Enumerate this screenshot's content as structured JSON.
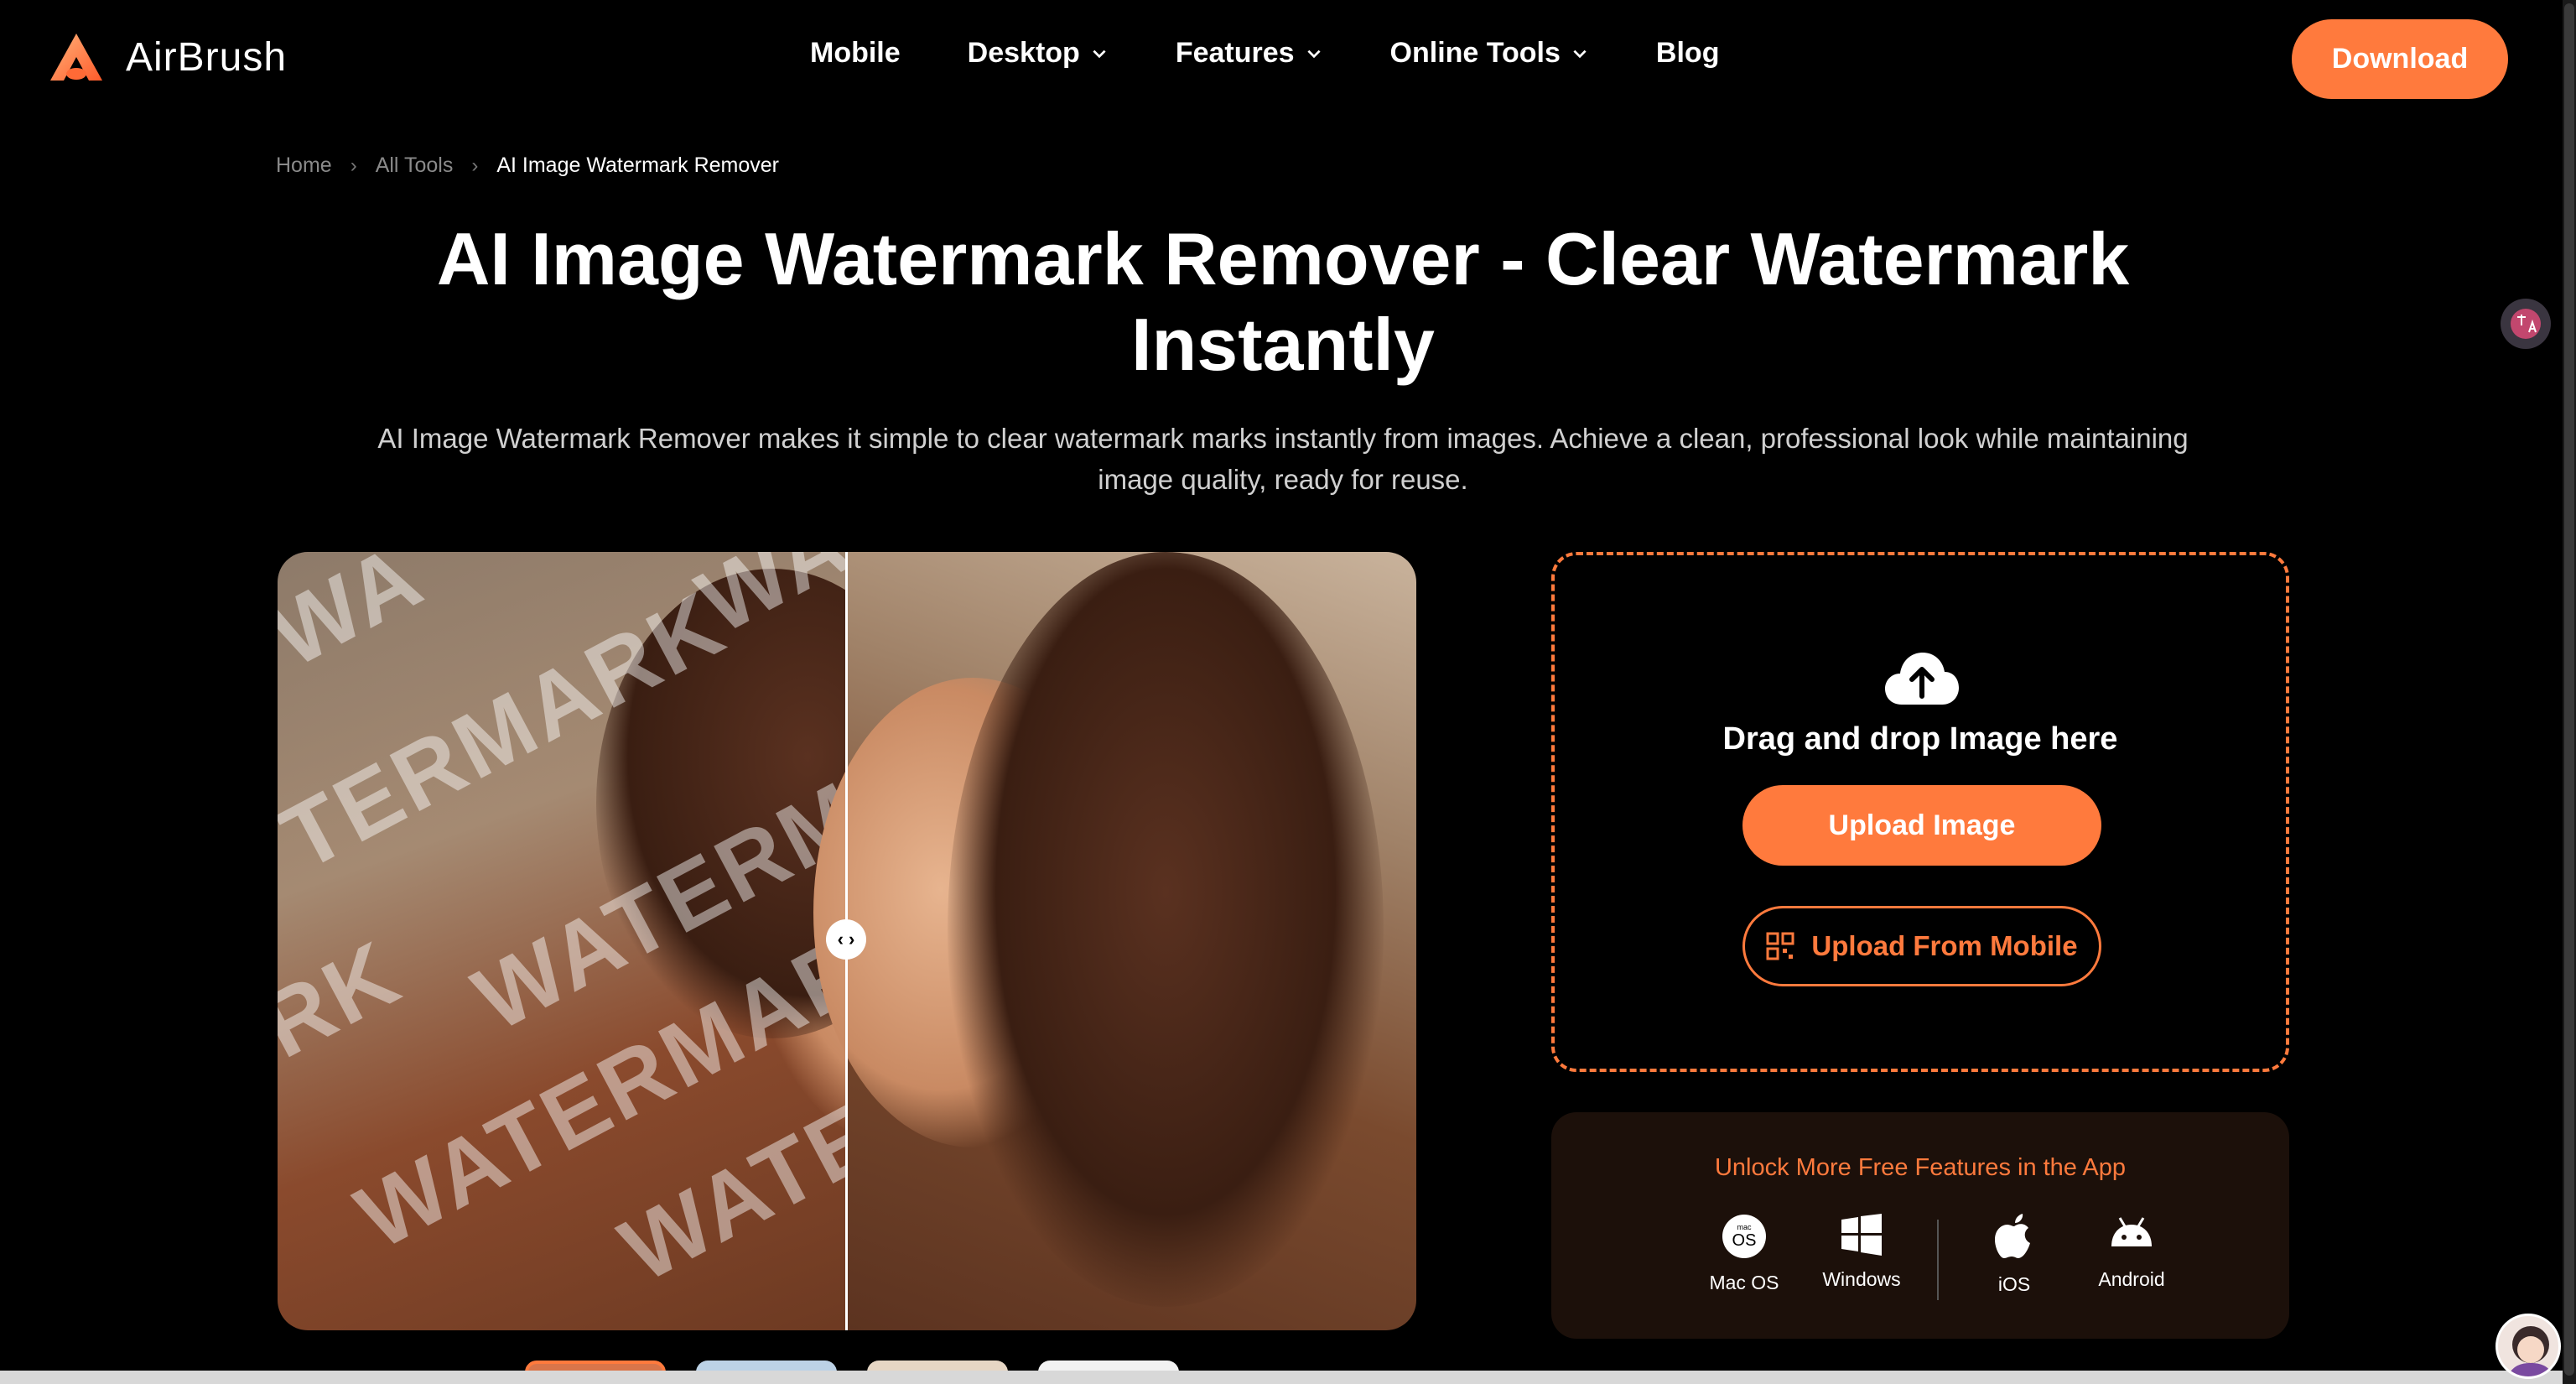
{
  "header": {
    "brand": "AirBrush",
    "nav": [
      {
        "label": "Mobile",
        "dropdown": false
      },
      {
        "label": "Desktop",
        "dropdown": true
      },
      {
        "label": "Features",
        "dropdown": true
      },
      {
        "label": "Online Tools",
        "dropdown": true
      },
      {
        "label": "Blog",
        "dropdown": false
      }
    ],
    "download_label": "Download"
  },
  "breadcrumb": [
    "Home",
    "All Tools",
    "AI Image Watermark Remover"
  ],
  "hero": {
    "title_line1": "AI Image Watermark Remover - Clear Watermark",
    "title_line2": "Instantly",
    "subtitle_line1": "AI Image Watermark Remover makes it simple to clear watermark marks instantly from images. Achieve a clean, professional look while maintaining",
    "subtitle_line2": "image quality, ready for reuse."
  },
  "compare": {
    "watermark_text": "WATERMARK",
    "watermark_fragments": [
      "WA",
      "TERMARK",
      "WATERMARK",
      "RK",
      "WATERMARK",
      "WATE",
      "WA"
    ]
  },
  "upload": {
    "drop_text": "Drag and drop Image here",
    "upload_label": "Upload Image",
    "mobile_label": "Upload From Mobile"
  },
  "app": {
    "title": "Unlock More Free Features in the App",
    "platforms": [
      {
        "label": "Mac OS",
        "icon": "macos-icon"
      },
      {
        "label": "Windows",
        "icon": "windows-icon"
      },
      {
        "label": "iOS",
        "icon": "apple-icon"
      },
      {
        "label": "Android",
        "icon": "android-icon"
      }
    ]
  },
  "colors": {
    "accent": "#ff7a3d",
    "background": "#000000",
    "card": "#1c100a"
  }
}
